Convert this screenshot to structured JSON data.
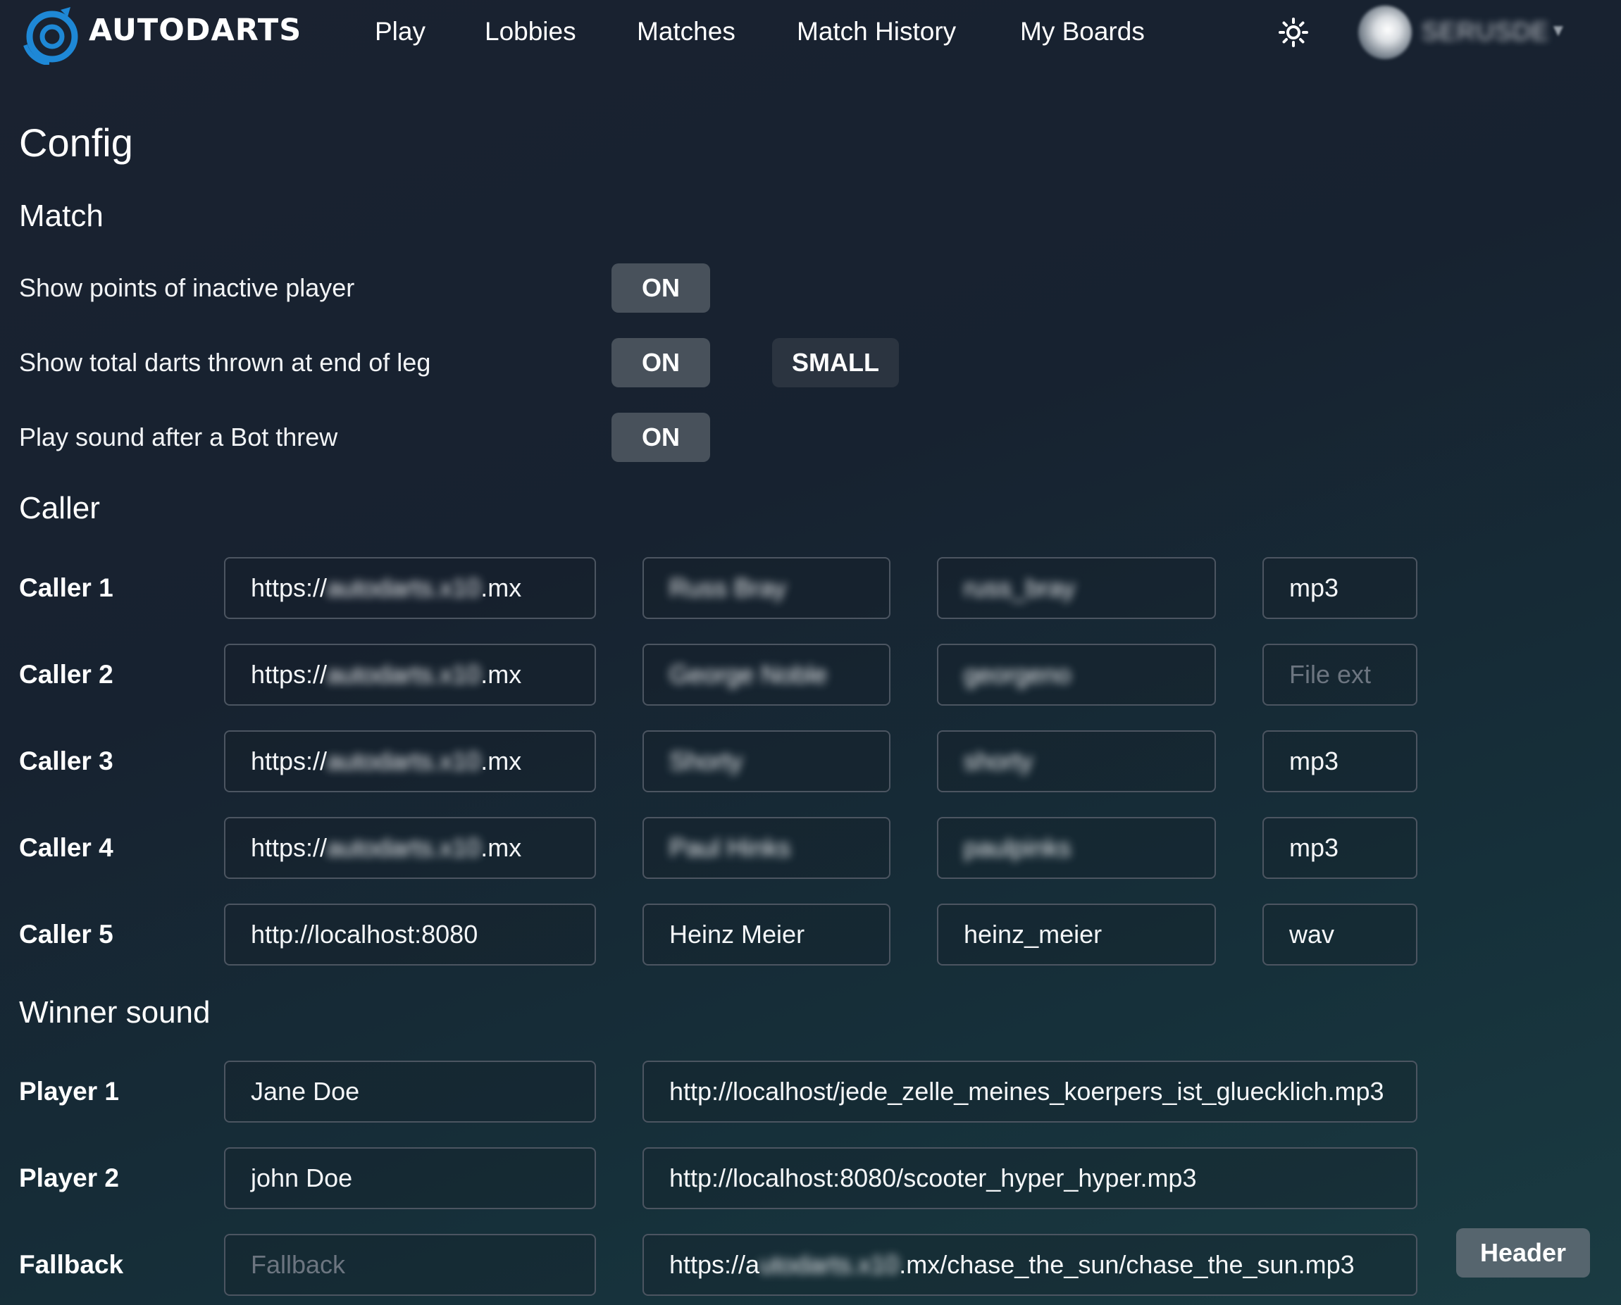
{
  "nav": {
    "brand": "AUTODARTS",
    "links": [
      "Play",
      "Lobbies",
      "Matches",
      "Match History",
      "My Boards"
    ],
    "username": "SERUSDE",
    "theme_icon": "sun-icon"
  },
  "page": {
    "title": "Config"
  },
  "match": {
    "heading": "Match",
    "settings": [
      {
        "label": "Show points of inactive player",
        "toggle": "ON"
      },
      {
        "label": "Show total darts thrown at end of leg",
        "toggle": "ON",
        "size": "SMALL"
      },
      {
        "label": "Play sound after a Bot threw",
        "toggle": "ON"
      }
    ]
  },
  "caller": {
    "heading": "Caller",
    "rows": [
      {
        "label": "Caller 1",
        "url_prefix": "https://",
        "url_hidden": "autodarts.x10",
        "url_suffix": ".mx",
        "name": "Russ Bray",
        "id": "russ_bray",
        "ext": "mp3",
        "ext_placeholder": ""
      },
      {
        "label": "Caller 2",
        "url_prefix": "https://",
        "url_hidden": "autodarts.x10",
        "url_suffix": ".mx",
        "name": "George Noble",
        "id": "georgeno",
        "ext": "",
        "ext_placeholder": "File ext"
      },
      {
        "label": "Caller 3",
        "url_prefix": "https://",
        "url_hidden": "autodarts.x10",
        "url_suffix": ".mx",
        "name": "Shorty",
        "id": "shorty",
        "ext": "mp3",
        "ext_placeholder": ""
      },
      {
        "label": "Caller 4",
        "url_prefix": "https://",
        "url_hidden": "autodarts.x10",
        "url_suffix": ".mx",
        "name": "Paul Hinks",
        "id": "paulpinks",
        "ext": "mp3",
        "ext_placeholder": ""
      },
      {
        "label": "Caller 5",
        "url_prefix": "http://localhost:8080",
        "url_hidden": "",
        "url_suffix": "",
        "name": "Heinz Meier",
        "id": "heinz_meier",
        "ext": "wav",
        "ext_placeholder": ""
      }
    ]
  },
  "winner": {
    "heading": "Winner sound",
    "rows": [
      {
        "label": "Player 1",
        "name": "Jane Doe",
        "name_placeholder": "",
        "url_prefix": "http://localhost/jede_zelle_meines_koerpers_ist_gluecklich.mp3",
        "url_hidden": "",
        "url_suffix": ""
      },
      {
        "label": "Player 2",
        "name": "john Doe",
        "name_placeholder": "",
        "url_prefix": "http://localhost:8080/scooter_hyper_hyper.mp3",
        "url_hidden": "",
        "url_suffix": ""
      },
      {
        "label": "Fallback",
        "name": "",
        "name_placeholder": "Fallback",
        "url_prefix": "https://a",
        "url_hidden": "utodarts.x10",
        "url_suffix": ".mx/chase_the_sun/chase_the_sun.mp3"
      }
    ]
  },
  "header_button": "Header",
  "colors": {
    "accent": "#1e88d6",
    "toggle_bg": "#48515b",
    "field_border": "#4c5561"
  }
}
